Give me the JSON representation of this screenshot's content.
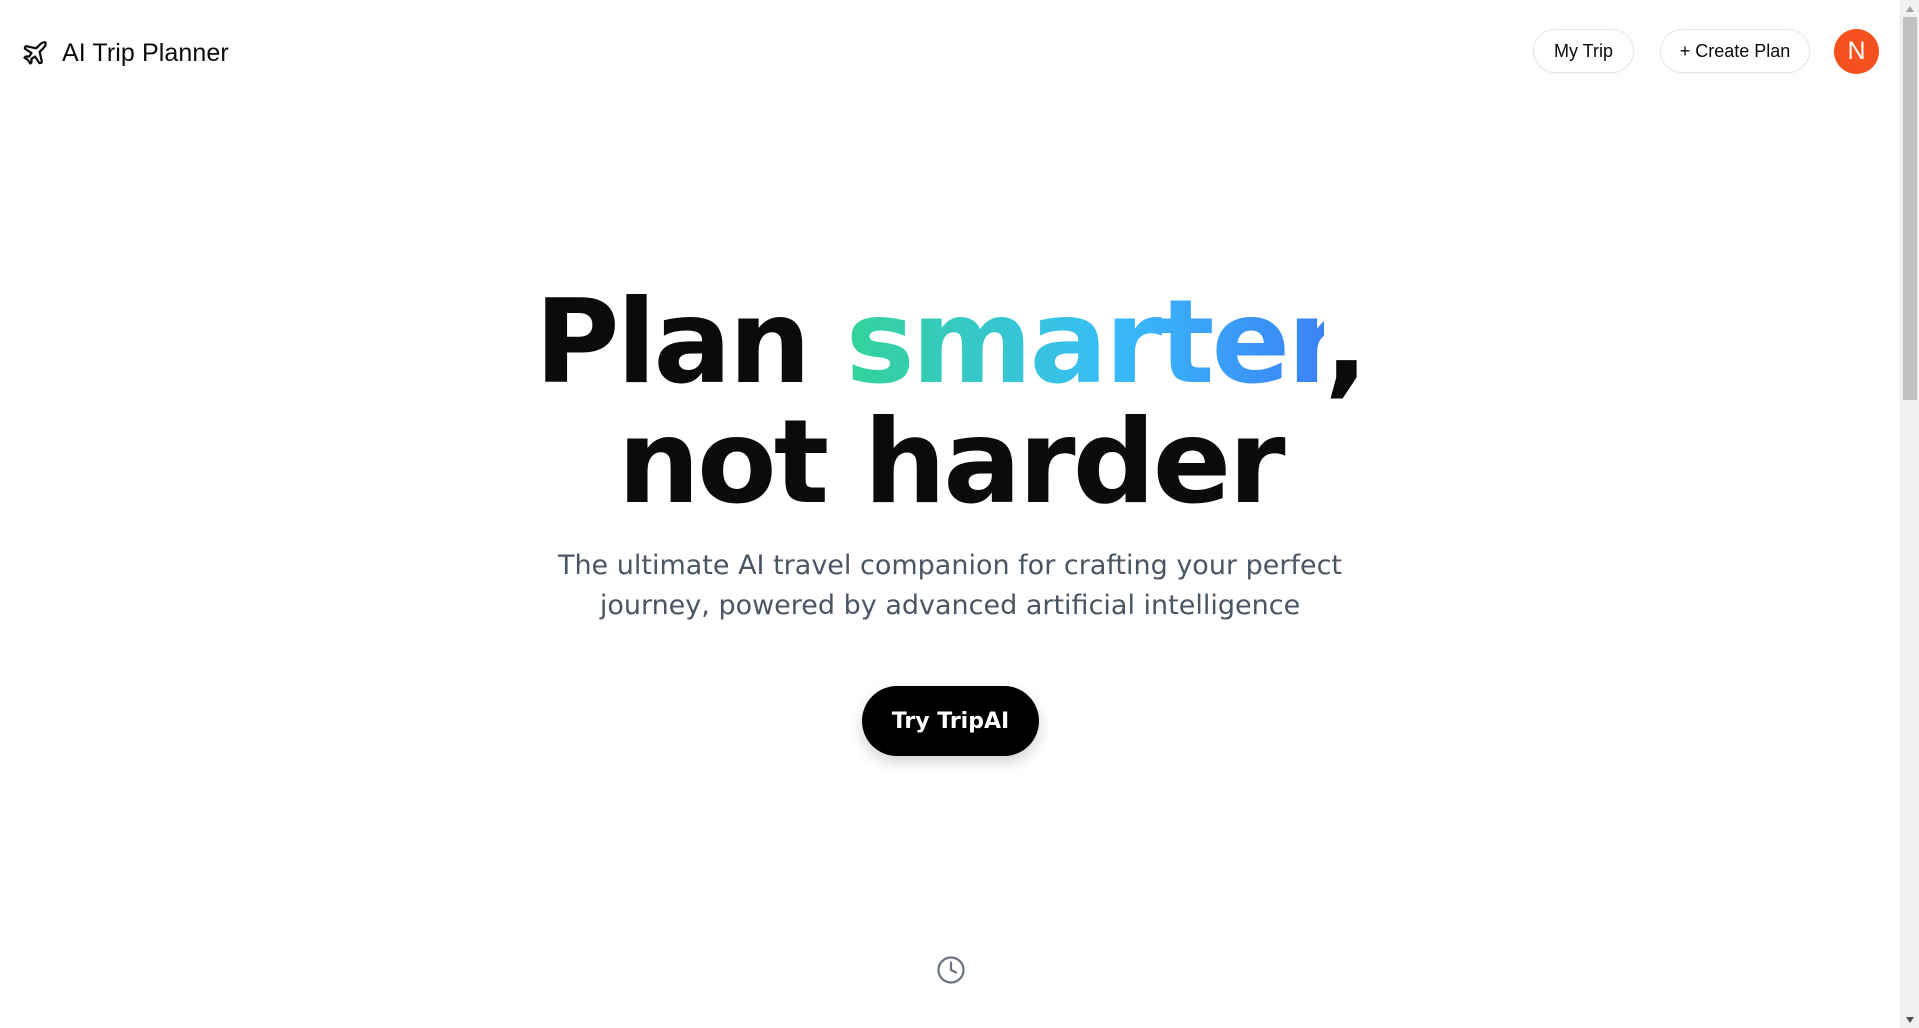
{
  "header": {
    "brand_title": "AI Trip Planner",
    "brand_icon": "plane-icon",
    "my_trip_label": "My Trip",
    "create_plan_label": "+ Create Plan",
    "avatar_initial": "N",
    "avatar_color": "#f4511e"
  },
  "hero": {
    "headline_part1": "Plan ",
    "headline_accent": "smarter",
    "headline_part2": ",",
    "headline_line2": "not harder",
    "subtitle": "The ultimate AI travel companion for crafting your perfect journey, powered by advanced artificial intelligence",
    "cta_label": "Try TripAI",
    "accent_gradient": [
      "#34d399",
      "#38bdf8",
      "#3b82f6"
    ],
    "bottom_icon": "clock-icon"
  },
  "scrollbar": {
    "thumb_color": "#c1c1c1",
    "track_color": "#f1f1f1"
  }
}
